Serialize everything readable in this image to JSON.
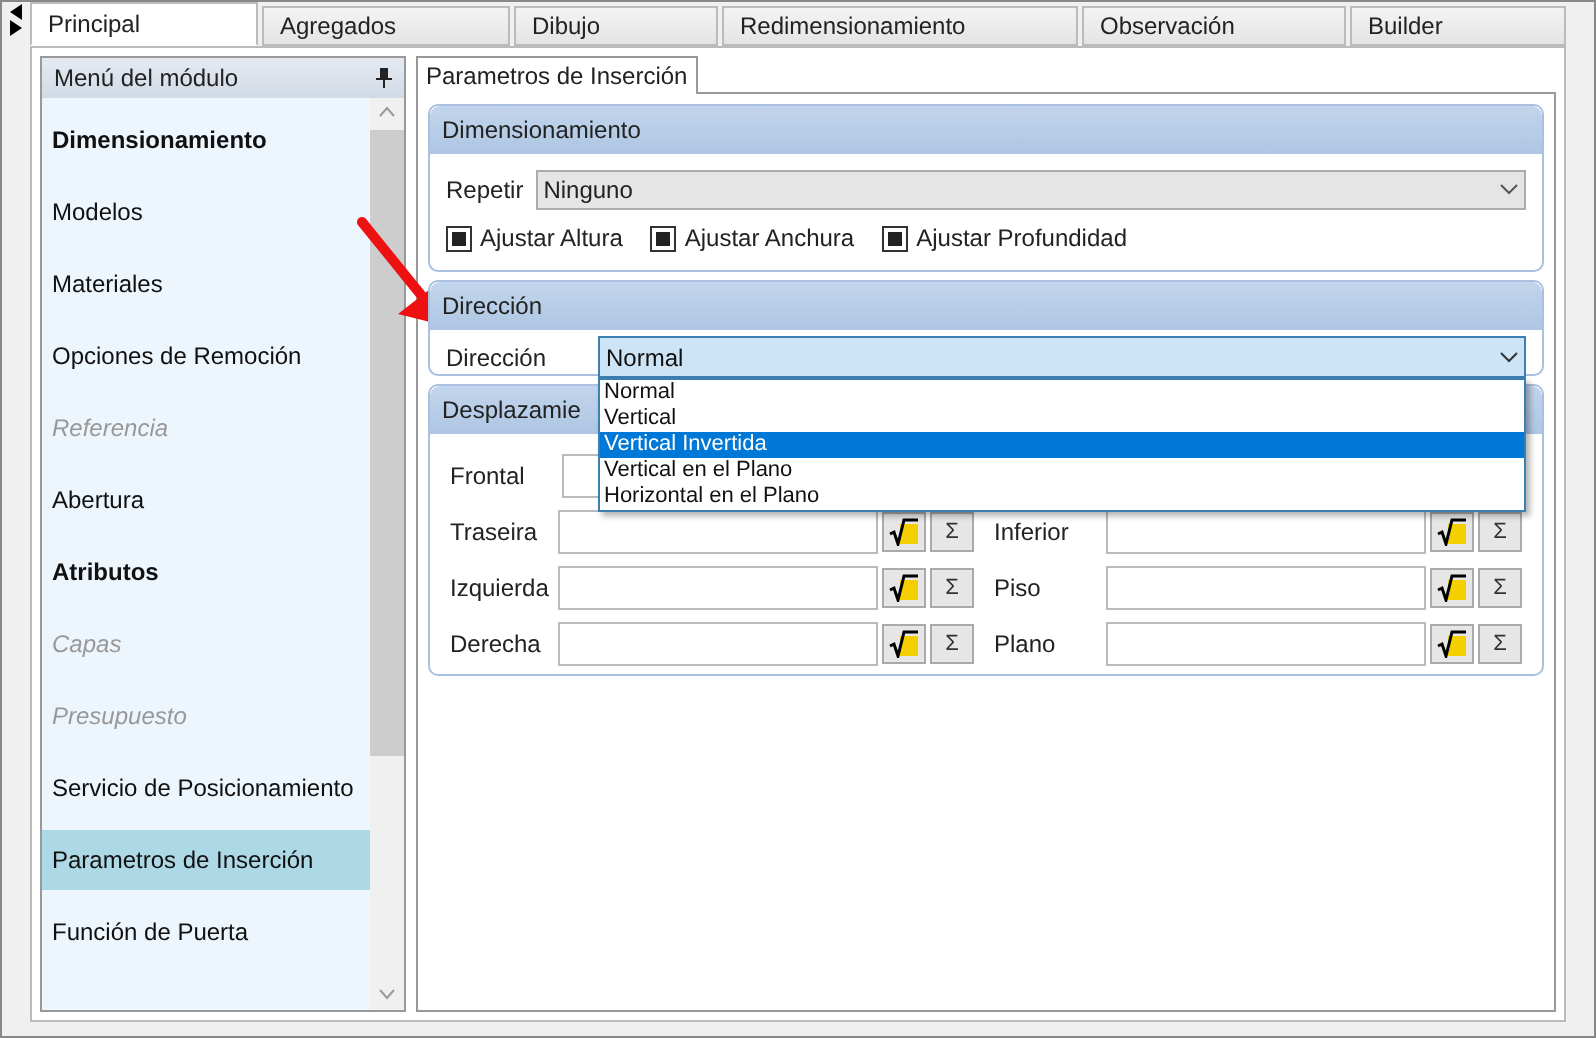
{
  "tabs": [
    {
      "label": "Principal",
      "selected": true
    },
    {
      "label": "Agregados",
      "selected": false
    },
    {
      "label": "Dibujo",
      "selected": false
    },
    {
      "label": "Redimensionamiento",
      "selected": false
    },
    {
      "label": "Observación",
      "selected": false
    },
    {
      "label": "Builder",
      "selected": false
    }
  ],
  "sidebar": {
    "title": "Menú del módulo",
    "items": [
      {
        "label": "Dimensionamiento",
        "kind": "header",
        "disabled": false,
        "selected": false
      },
      {
        "label": "Modelos",
        "kind": "item",
        "disabled": false,
        "selected": false
      },
      {
        "label": "Materiales",
        "kind": "item",
        "disabled": false,
        "selected": false
      },
      {
        "label": "Opciones de Remoción",
        "kind": "item",
        "disabled": false,
        "selected": false
      },
      {
        "label": "Referencia",
        "kind": "item",
        "disabled": true,
        "selected": false
      },
      {
        "label": "Abertura",
        "kind": "item",
        "disabled": false,
        "selected": false
      },
      {
        "label": "Atributos",
        "kind": "header",
        "disabled": false,
        "selected": false
      },
      {
        "label": "Capas",
        "kind": "item",
        "disabled": true,
        "selected": false
      },
      {
        "label": "Presupuesto",
        "kind": "item",
        "disabled": true,
        "selected": false
      },
      {
        "label": "Servicio de Posicionamiento",
        "kind": "item",
        "disabled": false,
        "selected": false
      },
      {
        "label": "Parametros de Inserción",
        "kind": "item",
        "disabled": false,
        "selected": true
      },
      {
        "label": "Función de Puerta",
        "kind": "item",
        "disabled": false,
        "selected": false
      }
    ]
  },
  "panel_tab": "Parametros de Inserción",
  "dimensionamiento": {
    "title": "Dimensionamiento",
    "repeat_label": "Repetir",
    "repeat_value": "Ninguno",
    "checkboxes": [
      {
        "label": "Ajustar Altura",
        "checked": true
      },
      {
        "label": "Ajustar Anchura",
        "checked": true
      },
      {
        "label": "Ajustar Profundidad",
        "checked": true
      }
    ]
  },
  "direccion": {
    "title": "Dirección",
    "label": "Dirección",
    "value": "Normal",
    "options": [
      {
        "label": "Normal",
        "highlighted": false
      },
      {
        "label": "Vertical",
        "highlighted": false
      },
      {
        "label": "Vertical Invertida",
        "highlighted": true
      },
      {
        "label": "Vertical en el Plano",
        "highlighted": false
      },
      {
        "label": "Horizontal en el Plano",
        "highlighted": false
      }
    ]
  },
  "desplazamiento": {
    "title": "Desplazamie",
    "rows": [
      {
        "left": {
          "label": "Frontal"
        }
      },
      {
        "left": {
          "label": "Traseira",
          "sigma": "Σ"
        },
        "right": {
          "label": "Inferior",
          "sigma": "Σ"
        }
      },
      {
        "left": {
          "label": "Izquierda",
          "sigma": "Σ"
        },
        "right": {
          "label": "Piso",
          "sigma": "Σ"
        }
      },
      {
        "left": {
          "label": "Derecha",
          "sigma": "Σ"
        },
        "right": {
          "label": "Plano",
          "sigma": "Σ"
        }
      }
    ]
  }
}
